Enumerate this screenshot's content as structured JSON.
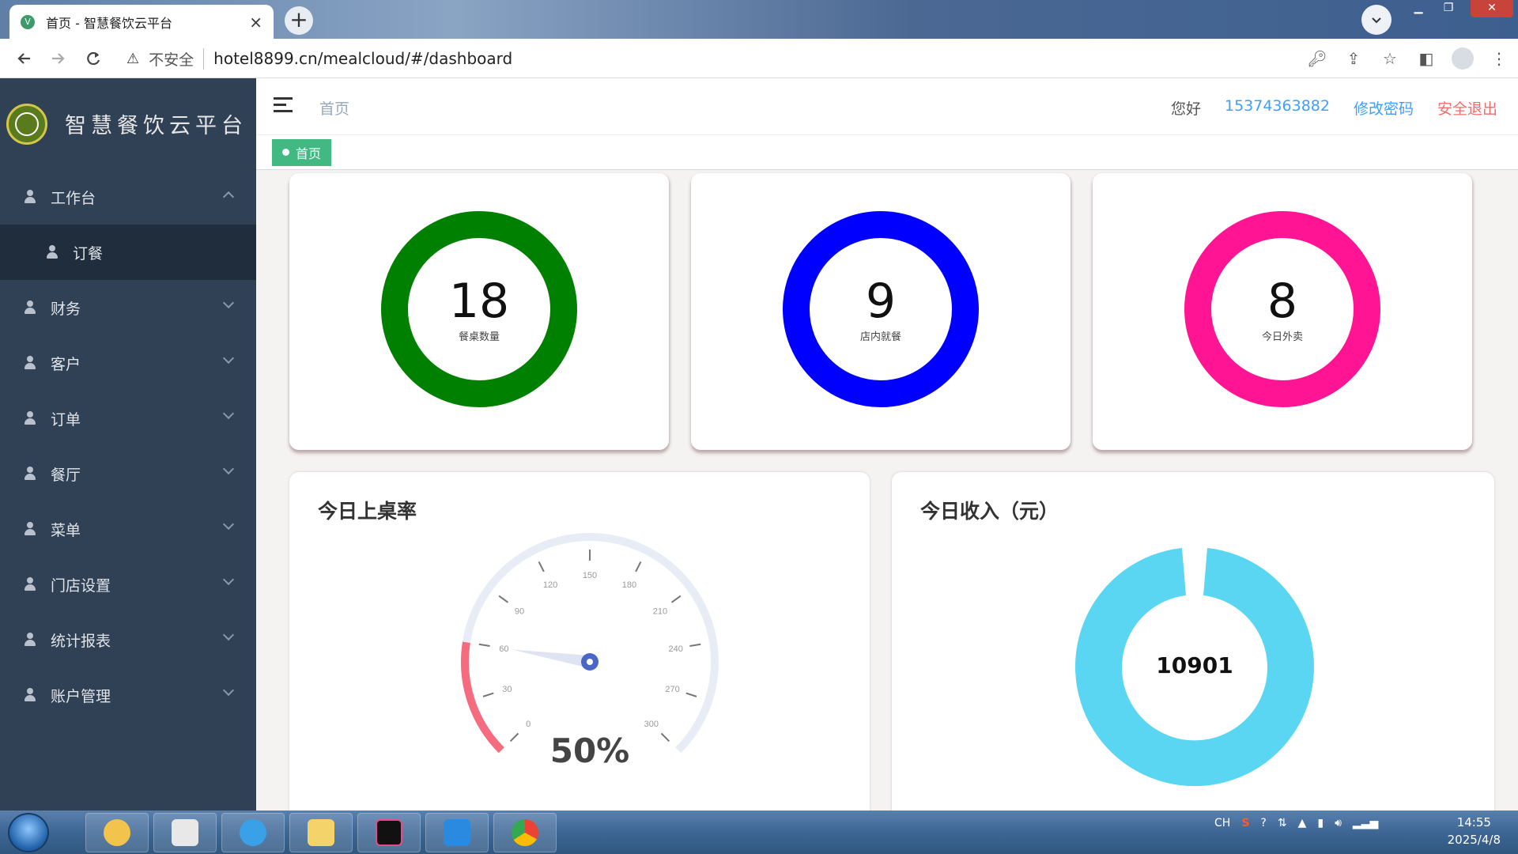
{
  "browser": {
    "tab_title": "首页 - 智慧餐饮云平台",
    "tab_favicon": "V",
    "tab_close": "×",
    "new_tab": "+",
    "security_label": "不安全",
    "url": "hotel8899.cn/mealcloud/#/dashboard"
  },
  "sidebar": {
    "brand_name": "智慧餐饮云平台",
    "menu": [
      {
        "label": "工作台",
        "expanded": true
      },
      {
        "label": "财务"
      },
      {
        "label": "客户"
      },
      {
        "label": "订单"
      },
      {
        "label": "餐厅"
      },
      {
        "label": "菜单"
      },
      {
        "label": "门店设置"
      },
      {
        "label": "统计报表"
      },
      {
        "label": "账户管理"
      }
    ],
    "submenu": [
      {
        "label": "订餐"
      }
    ]
  },
  "header": {
    "breadcrumb": "首页",
    "greeting": "您好",
    "phone": "15374363882",
    "change_password": "修改密码",
    "logout": "安全退出"
  },
  "tags": {
    "active": "首页"
  },
  "stats": [
    {
      "value": "18",
      "label": "餐桌数量",
      "color": "#008000"
    },
    {
      "value": "9",
      "label": "店内就餐",
      "color": "#0000ff"
    },
    {
      "value": "8",
      "label": "今日外卖",
      "color": "#ff1493"
    }
  ],
  "occupancy": {
    "title": "今日上桌率",
    "percent_text": "50%",
    "gauge_min": 0,
    "gauge_max": 300,
    "ticks": [
      "0",
      "30",
      "60",
      "90",
      "120",
      "150",
      "180",
      "210",
      "240",
      "270",
      "300"
    ],
    "pointer_value": 60,
    "arc_color": "#f56c80",
    "pointer_color": "#4a67c7"
  },
  "revenue": {
    "title": "今日收入（元）",
    "value": "10901",
    "color": "#5bd6f2"
  },
  "taskbar": {
    "clock_time": "14:55",
    "clock_date": "2025/4/8",
    "ime": "CH"
  }
}
